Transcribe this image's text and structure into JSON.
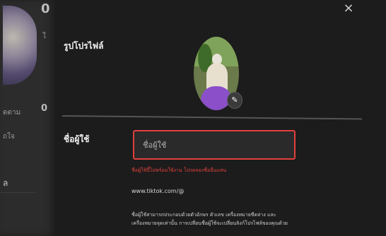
{
  "background": {
    "digit_top": "0",
    "digit_bottom": "0",
    "label_a": "ใ",
    "label_b": "ดตาม",
    "label_c": "ใ",
    "label_d": "ถใจ",
    "label_e": "ล"
  },
  "modal": {
    "close_label": "×",
    "profile_photo_label": "รูปโปรไฟล์",
    "edit_icon": "pencil-icon",
    "username_label": "ชื่อผู้ใช้",
    "username_placeholder": "ชื่อผู้ใช้",
    "error_text": "ชื่อผู้ใช้นี้ไม่พร้อมใช้งาน โปรดลองชื่ออื่นแทน",
    "profile_url": "www.tiktok.com/@",
    "help_text_line1": "ชื่อผู้ใช้สามารถประกอบด้วยตัวอักษร ตัวเลข เครื่องหมายขีดล่าง และ",
    "help_text_line2": "เครื่องหมายจุดเท่านั้น การเปลี่ยนชื่อผู้ใช้จะเปลี่ยนลิงก์โปรไฟล์ของคุณด้วย"
  },
  "colors": {
    "error": "#e0403c",
    "modal_bg": "#1c1c1c"
  }
}
